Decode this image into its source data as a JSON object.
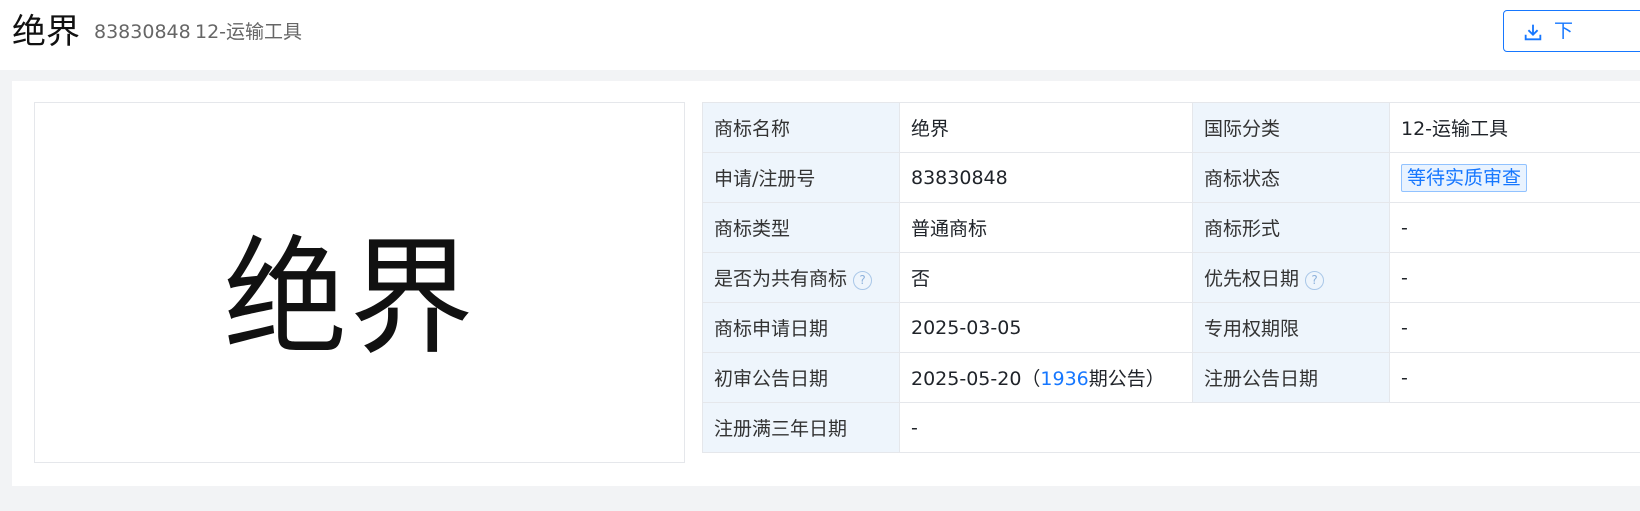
{
  "header": {
    "title": "绝界",
    "reg_number": "83830848",
    "category": "12-运输工具",
    "download_label": "下"
  },
  "logo": {
    "text": "绝界"
  },
  "info": {
    "rows": [
      {
        "label1": "商标名称",
        "value1": "绝界",
        "label2": "国际分类",
        "value2": "12-运输工具"
      },
      {
        "label1": "申请/注册号",
        "value1": "83830848",
        "label2": "商标状态",
        "value2": "等待实质审查"
      },
      {
        "label1": "商标类型",
        "value1": "普通商标",
        "label2": "商标形式",
        "value2": "-"
      },
      {
        "label1": "是否为共有商标",
        "value1": "否",
        "label2": "优先权日期",
        "value2": "-"
      },
      {
        "label1": "商标申请日期",
        "value1": "2025-03-05",
        "label2": "专用权期限",
        "value2": "-"
      },
      {
        "label1": "初审公告日期",
        "value1_prefix": "2025-05-20（",
        "value1_link": "1936",
        "value1_suffix": "期公告）",
        "label2": "注册公告日期",
        "value2": "-"
      },
      {
        "label1": "注册满三年日期",
        "value1": "-"
      }
    ],
    "help_icon": "?"
  },
  "colors": {
    "accent": "#1677ff",
    "label_bg": "#eef5fc"
  }
}
